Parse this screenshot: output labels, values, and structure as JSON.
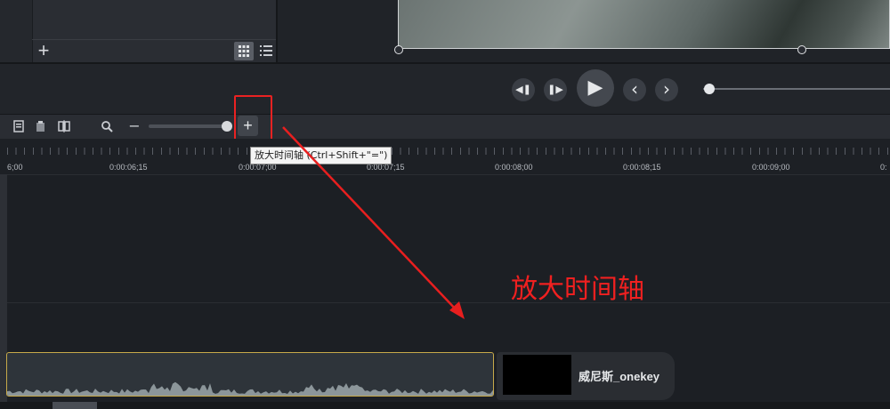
{
  "media_bin": {
    "add_label": "+"
  },
  "playback": {
    "prev_label": "◀❚",
    "next_label": "❚▶",
    "play_label": "▶",
    "step_back_label": "‹",
    "step_forward_label": "›"
  },
  "toolbar": {
    "zoom_out_label": "−",
    "zoom_in_label": "+",
    "tooltip": "放大时间轴 (Ctrl+Shift+\"=\")"
  },
  "ruler": {
    "ticks": [
      "6;00",
      "0:00:06;15",
      "0:00:07;00",
      "0:00:07;15",
      "0:00:08;00",
      "0:00:08;15",
      "0:00:09;00",
      "0:"
    ]
  },
  "timeline": {
    "video_clip_label": "威尼斯_onekey"
  },
  "annotation": {
    "text": "放大时间轴"
  },
  "colors": {
    "highlight": "#ea2222",
    "clip_border": "#c7a94a",
    "background": "#1c1f24"
  }
}
